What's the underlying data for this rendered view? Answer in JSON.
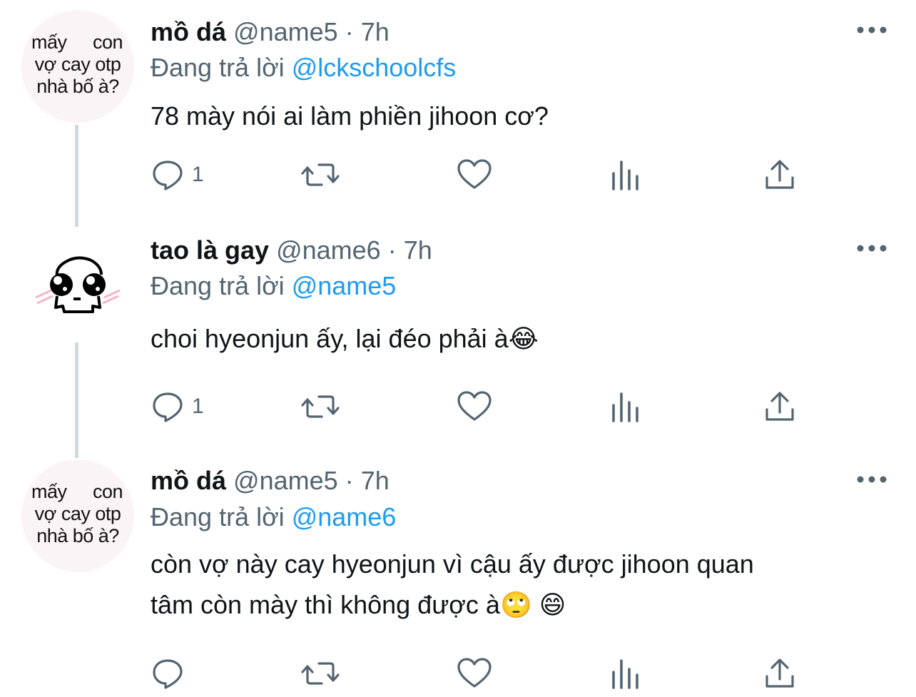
{
  "tweets": [
    {
      "avatar_text": [
        "mấy",
        "con",
        "vợ cay otp",
        "nhà bố à?"
      ],
      "display_name": "mồ dá",
      "handle": "@name5",
      "separator": "·",
      "time": "7h",
      "reply_label": "Đang trả lời",
      "reply_to": "@lckschoolcfs",
      "text": "78 mày nói ai làm phiền jihoon cơ?",
      "reply_count": "1"
    },
    {
      "display_name": "tao là gay",
      "handle": "@name6",
      "separator": "·",
      "time": "7h",
      "reply_label": "Đang trả lời",
      "reply_to": "@name5",
      "text": "choi hyeonjun ấy, lại đéo phải à😂",
      "reply_count": "1"
    },
    {
      "avatar_text": [
        "mấy",
        "con",
        "vợ cay otp",
        "nhà bố à?"
      ],
      "display_name": "mồ dá",
      "handle": "@name5",
      "separator": "·",
      "time": "7h",
      "reply_label": "Đang trả lời",
      "reply_to": "@name6",
      "text_line1": "còn vợ này cay hyeonjun vì cậu ấy được jihoon quan",
      "text_line2": "tâm còn mày thì không được à🙄 😄",
      "reply_count": ""
    }
  ],
  "icons": {
    "reply": "reply-icon",
    "retweet": "retweet-icon",
    "like": "heart-icon",
    "views": "views-icon",
    "share": "share-icon",
    "more": "more-icon"
  },
  "colors": {
    "text": "#0f1419",
    "secondary": "#536471",
    "link": "#1d9bf0",
    "thread_line": "#cfd9de"
  }
}
